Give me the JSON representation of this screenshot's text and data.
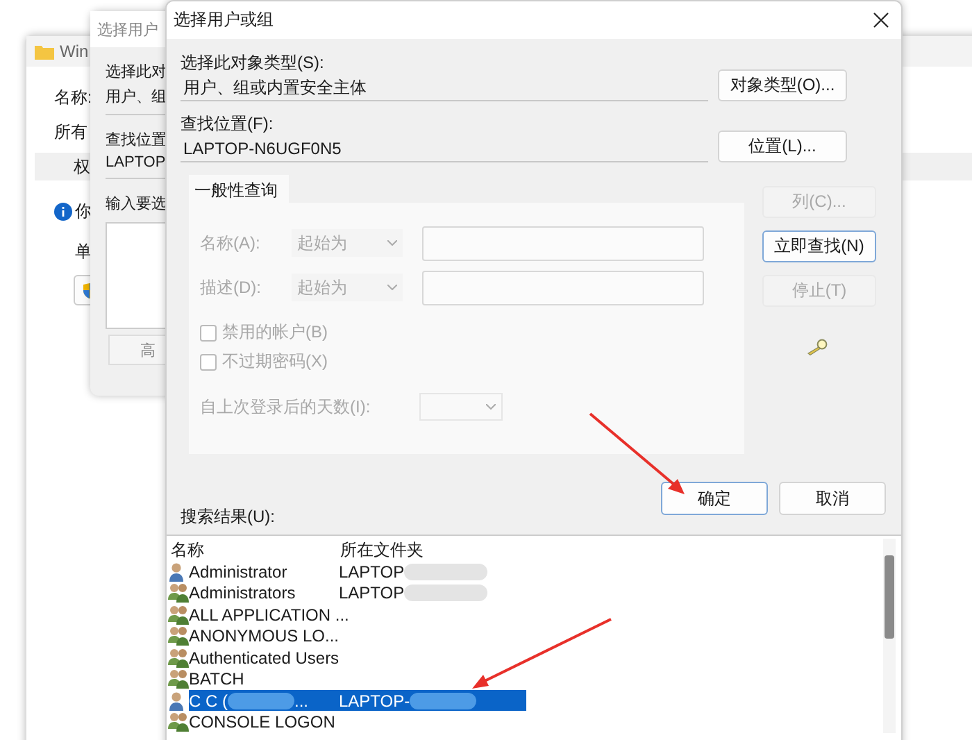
{
  "properties_window": {
    "title": "Win",
    "labels": [
      "名称:",
      "所有"
    ],
    "tab": "权",
    "info_text": "你",
    "group_label": "单"
  },
  "back_dialog": {
    "title": "选择用户",
    "type_label": "选择此对",
    "type_value": "用户、组",
    "location_label": "查找位置",
    "location_value": "LAPTOP",
    "enter_label": "输入要选",
    "advanced_button": "高"
  },
  "dialog": {
    "title": "选择用户或组",
    "object_type": {
      "label": "选择此对象类型(S):",
      "value": "用户、组或内置安全主体",
      "button": "对象类型(O)..."
    },
    "location": {
      "label": "查找位置(F):",
      "value": "LAPTOP-N6UGF0N5",
      "button": "位置(L)..."
    },
    "query": {
      "tab": "一般性查询",
      "disabled": true,
      "name_label": "名称(A):",
      "name_mode": "起始为",
      "desc_label": "描述(D):",
      "desc_mode": "起始为",
      "checkboxes": [
        {
          "label": "禁用的帐户(B)",
          "checked": false
        },
        {
          "label": "不过期密码(X)",
          "checked": false
        }
      ],
      "days_label": "自上次登录后的天数(I):"
    },
    "side_buttons": [
      {
        "label": "列(C)...",
        "disabled": true,
        "focused": false
      },
      {
        "label": "立即查找(N)",
        "disabled": false,
        "focused": true
      },
      {
        "label": "停止(T)",
        "disabled": true,
        "focused": false
      }
    ],
    "ok_button": "确定",
    "cancel_button": "取消",
    "results": {
      "label": "搜索结果(U):",
      "columns": [
        "名称",
        "所在文件夹"
      ],
      "rows": [
        {
          "kind": "user",
          "name": "Administrator",
          "folder": "LAPTOP",
          "folder_blurred": true,
          "selected": false
        },
        {
          "kind": "group",
          "name": "Administrators",
          "folder": "LAPTOP",
          "folder_blurred": true,
          "selected": false
        },
        {
          "kind": "group",
          "name": "ALL APPLICATION ...",
          "selected": false
        },
        {
          "kind": "group",
          "name": "ANONYMOUS LO...",
          "selected": false
        },
        {
          "kind": "group",
          "name": "Authenticated Users",
          "selected": false
        },
        {
          "kind": "group",
          "name": "BATCH",
          "selected": false
        },
        {
          "kind": "user",
          "name": "C C (",
          "name_blurred": true,
          "name_tail": "...",
          "folder": "LAPTOP-",
          "folder_blurred": true,
          "selected": true
        },
        {
          "kind": "group",
          "name": "CONSOLE LOGON",
          "selected": false
        }
      ]
    }
  }
}
